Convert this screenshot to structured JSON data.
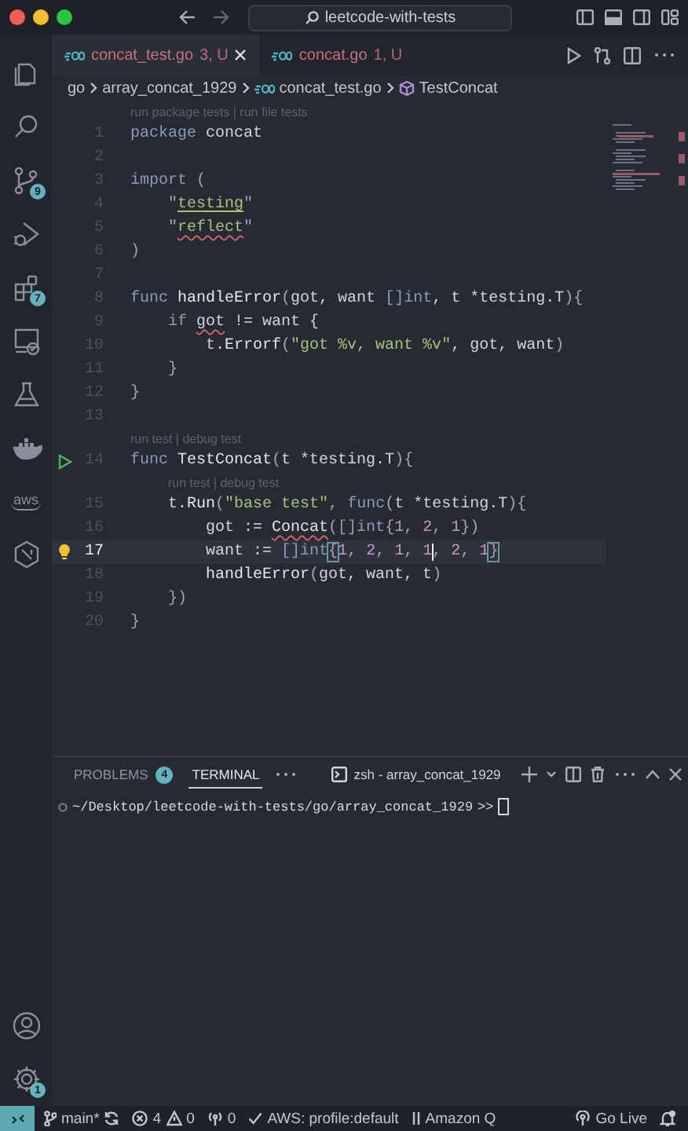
{
  "title_bar": {
    "search": "leetcode-with-tests"
  },
  "activity_bar": {
    "items": [
      {
        "kind": "files"
      },
      {
        "kind": "search"
      },
      {
        "kind": "source-control",
        "badge": "9"
      },
      {
        "kind": "run-debug"
      },
      {
        "kind": "extensions",
        "badge": "7"
      },
      {
        "kind": "remote"
      },
      {
        "kind": "testing"
      },
      {
        "kind": "docker"
      },
      {
        "kind": "aws",
        "label": "aws"
      },
      {
        "kind": "hexagon"
      }
    ],
    "bottom": [
      {
        "kind": "account"
      },
      {
        "kind": "settings",
        "badge": "1"
      }
    ]
  },
  "tabs": [
    {
      "name": "concat_test.go",
      "status": "3, U",
      "selected": true
    },
    {
      "name": "concat.go",
      "status": "1, U",
      "selected": false
    }
  ],
  "breadcrumb": [
    {
      "kind": "folder",
      "label": "go"
    },
    {
      "kind": "folder",
      "label": "array_concat_1929"
    },
    {
      "kind": "file",
      "label": "concat_test.go"
    },
    {
      "kind": "symbol",
      "label": "TestConcat"
    }
  ],
  "code_lines": [
    {
      "number": "1",
      "lens": {
        "text": "run package tests | run file tests",
        "indented": false
      },
      "tokens": [
        {
          "kind": "kw",
          "text": "package"
        },
        {
          "kind": "ident",
          "text": " concat"
        }
      ]
    },
    {
      "number": "2"
    },
    {
      "number": "3",
      "tokens": [
        {
          "kind": "kw",
          "text": "import"
        },
        {
          "kind": "punc",
          "text": " ("
        }
      ]
    },
    {
      "number": "4",
      "tokens": [
        {
          "kind": "punc",
          "text": "    \""
        },
        {
          "kind": "str",
          "text": "testing",
          "warning_underline": true
        },
        {
          "kind": "punc",
          "text": "\""
        }
      ]
    },
    {
      "number": "5",
      "tokens": [
        {
          "kind": "punc",
          "text": "    \""
        },
        {
          "kind": "str",
          "text": "reflect",
          "error_squiggle": true
        },
        {
          "kind": "punc",
          "text": "\""
        }
      ]
    },
    {
      "number": "6",
      "tokens": [
        {
          "kind": "punc",
          "text": ")"
        }
      ]
    },
    {
      "number": "7"
    },
    {
      "number": "8",
      "tokens": [
        {
          "kind": "kw",
          "text": "func"
        },
        {
          "kind": "fn",
          "text": " handleError"
        },
        {
          "kind": "punc",
          "text": "("
        },
        {
          "kind": "ident",
          "text": "got, want "
        },
        {
          "kind": "type",
          "text": "[]int"
        },
        {
          "kind": "ident",
          "text": ", t *testing.T"
        },
        {
          "kind": "punc",
          "text": "){"
        }
      ]
    },
    {
      "number": "9",
      "tokens": [
        {
          "kind": "kw",
          "text": "    if "
        },
        {
          "kind": "ident",
          "text": "got",
          "error_squiggle": true
        },
        {
          "kind": "ident",
          "text": " != want {"
        }
      ]
    },
    {
      "number": "10",
      "tokens": [
        {
          "kind": "ident",
          "text": "        t."
        },
        {
          "kind": "fn",
          "text": "Errorf"
        },
        {
          "kind": "punc",
          "text": "("
        },
        {
          "kind": "str",
          "text": "\"got %v, want %v\""
        },
        {
          "kind": "ident",
          "text": ", got, want"
        },
        {
          "kind": "punc",
          "text": ")"
        }
      ]
    },
    {
      "number": "11",
      "tokens": [
        {
          "kind": "punc",
          "text": "    }"
        }
      ]
    },
    {
      "number": "12",
      "tokens": [
        {
          "kind": "punc",
          "text": "}"
        }
      ]
    },
    {
      "number": "13"
    },
    {
      "number": "14",
      "run_button": true,
      "lens": {
        "text": "run test | debug test",
        "indented": false
      },
      "tokens": [
        {
          "kind": "kw",
          "text": "func"
        },
        {
          "kind": "fn",
          "text": " TestConcat"
        },
        {
          "kind": "punc",
          "text": "("
        },
        {
          "kind": "ident",
          "text": "t *testing.T"
        },
        {
          "kind": "punc",
          "text": "){"
        }
      ]
    },
    {
      "number": "15",
      "lens": {
        "text": "run test | debug test",
        "indented": true
      },
      "tokens": [
        {
          "kind": "ident",
          "text": "    t."
        },
        {
          "kind": "fn",
          "text": "Run"
        },
        {
          "kind": "punc",
          "text": "("
        },
        {
          "kind": "str",
          "text": "\"base test\""
        },
        {
          "kind": "punc",
          "text": ", "
        },
        {
          "kind": "kw",
          "text": "func"
        },
        {
          "kind": "punc",
          "text": "("
        },
        {
          "kind": "ident",
          "text": "t *testing.T"
        },
        {
          "kind": "punc",
          "text": "){"
        }
      ]
    },
    {
      "number": "16",
      "tokens": [
        {
          "kind": "ident",
          "text": "        got := "
        },
        {
          "kind": "fn",
          "text": "Concat",
          "error_squiggle": true
        },
        {
          "kind": "punc",
          "text": "("
        },
        {
          "kind": "type",
          "text": "[]int"
        },
        {
          "kind": "punc",
          "text": "{"
        },
        {
          "kind": "num",
          "text": "1"
        },
        {
          "kind": "punc",
          "text": ", "
        },
        {
          "kind": "num",
          "text": "2"
        },
        {
          "kind": "punc",
          "text": ", "
        },
        {
          "kind": "num",
          "text": "1"
        },
        {
          "kind": "punc",
          "text": "})"
        }
      ]
    },
    {
      "number": "17",
      "current": true,
      "lightbulb": true,
      "tokens": [
        {
          "kind": "ident",
          "text": "        want := "
        },
        {
          "kind": "type",
          "text": "[]int"
        },
        {
          "kind": "bracket",
          "text": "{"
        },
        {
          "kind": "num",
          "text": "1"
        },
        {
          "kind": "punc",
          "text": ", "
        },
        {
          "kind": "num",
          "text": "2"
        },
        {
          "kind": "punc",
          "text": ", "
        },
        {
          "kind": "num",
          "text": "1"
        },
        {
          "kind": "punc",
          "text": ", "
        },
        {
          "kind": "num",
          "text": "1",
          "cursor": true
        },
        {
          "kind": "punc",
          "text": ", "
        },
        {
          "kind": "num",
          "text": "2"
        },
        {
          "kind": "punc",
          "text": ", "
        },
        {
          "kind": "num",
          "text": "1"
        },
        {
          "kind": "bracket",
          "text": "}"
        }
      ]
    },
    {
      "number": "18",
      "tokens": [
        {
          "kind": "fn",
          "text": "        handleError"
        },
        {
          "kind": "punc",
          "text": "("
        },
        {
          "kind": "ident",
          "text": "got, want, t"
        },
        {
          "kind": "punc",
          "text": ")"
        }
      ]
    },
    {
      "number": "19",
      "tokens": [
        {
          "kind": "punc",
          "text": "    })"
        }
      ]
    },
    {
      "number": "20",
      "tokens": [
        {
          "kind": "punc",
          "text": "}"
        }
      ]
    }
  ],
  "panel": {
    "tabs": [
      {
        "label": "PROBLEMS",
        "badge": "4",
        "selected": false
      },
      {
        "label": "TERMINAL",
        "selected": true
      }
    ],
    "terminal_name": "zsh - array_concat_1929",
    "prompt_path": "~/Desktop/leetcode-with-tests/go/array_concat_1929",
    "prompt_symbol": ">>"
  },
  "status_bar": {
    "branch": "main*",
    "errors": "4",
    "warnings": "0",
    "ports": "0",
    "aws": "AWS: profile:default",
    "amazon_q": "Amazon Q",
    "go_live": "Go Live"
  }
}
